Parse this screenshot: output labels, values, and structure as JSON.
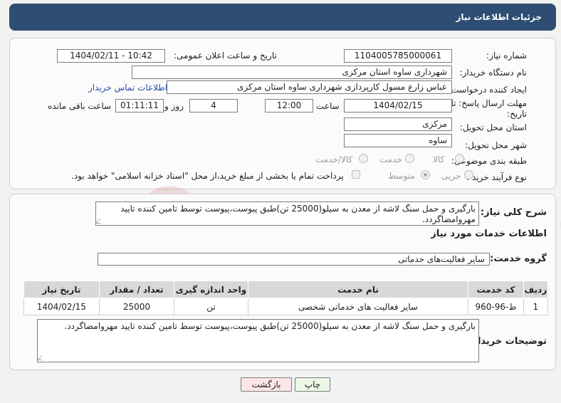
{
  "header": {
    "title": "جزئیات اطلاعات نیاز"
  },
  "fields": {
    "need_number_label": "شماره نیاز:",
    "need_number": "1104005785000061",
    "announce_label": "تاریخ و ساعت اعلان عمومی:",
    "announce_value": "1404/02/11 - 10:42",
    "buyer_org_label": "نام دستگاه خریدار:",
    "buyer_org": "شهرداری ساوه استان مرکزی",
    "creator_label": "ایجاد کننده درخواست:",
    "creator": "عباس زارع مسول کارپردازی شهرداری ساوه استان مرکزی",
    "contact_link": "اطلاعات تماس خریدار",
    "deadline_label_1": "مهلت ارسال پاسخ: تا",
    "deadline_label_2": "تاریخ:",
    "deadline_date": "1404/02/15",
    "time_label": "ساعت",
    "deadline_time": "12:00",
    "days_value": "4",
    "days_label": "روز و",
    "remaining_time": "01:11:11",
    "remaining_label": "ساعت باقی مانده",
    "province_label": "استان محل تحویل:",
    "province": "مرکزی",
    "city_label": "شهر محل تحویل:",
    "city": "ساوه",
    "category_label": "طبقه بندی موضوعی:",
    "category_options": [
      "کالا",
      "خدمت",
      "کالا/خدمت"
    ],
    "category_selected": "خدمت",
    "process_label": "نوع فرآیند خرید :",
    "process_options": [
      "جزیی",
      "متوسط"
    ],
    "process_selected": "متوسط",
    "payment_note": "پرداخت تمام یا بخشی از مبلغ خرید،از محل \"اسناد خزانه اسلامی\" خواهد بود."
  },
  "summary": {
    "label": "شرح کلی نیاز:",
    "text": "بارگیری و حمل سنگ لاشه از معدن به سیلو(25000 تن)طبق پیوست،پیوست توسط تامین کننده تایید مهروامضاگردد."
  },
  "services_section": {
    "title": "اطلاعات خدمات مورد نیاز",
    "group_label": "گروه خدمت:",
    "group_value": "سایر فعالیت‌های خدماتی"
  },
  "table": {
    "headers": [
      "ردیف",
      "کد خدمت",
      "نام خدمت",
      "واحد اندازه گیری",
      "تعداد / مقدار",
      "تاریخ نیاز"
    ],
    "rows": [
      [
        "1",
        "ط-96-960",
        "سایر فعالیت های خدماتی شخصی",
        "تن",
        "25000",
        "1404/02/15"
      ]
    ]
  },
  "buyer_notes": {
    "label": "توضیحات خریدار:",
    "text": "بارگیری و حمل سنگ لاشه از معدن به سیلو(25000 تن)طبق پیوست،پیوست توسط تامین کننده تایید مهروامضاگردد."
  },
  "buttons": {
    "print": "چاپ",
    "back": "بازگشت"
  },
  "watermark": {
    "text": "AriaTender.net"
  },
  "colors": {
    "header_bg": "#2e4d73",
    "link": "#2350a8",
    "back_button_bg": "#fde6e6",
    "print_button_bg": "#ecf7e6"
  }
}
